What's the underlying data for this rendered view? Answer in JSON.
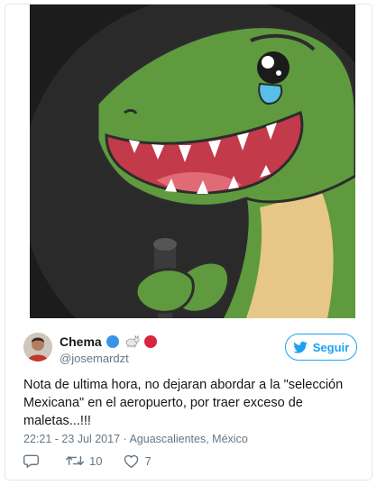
{
  "tweet": {
    "display_name": "Chema",
    "handle": "@josemardzt",
    "follow_label": "Seguir",
    "text": "Nota de ultima hora, no dejaran abordar a la \"selección Mexicana\" en el aeropuerto, por traer exceso de maletas...!!!",
    "timestamp": "22:21 - 23 Jul 2017",
    "separator": " · ",
    "location": "Aguascalientes, México",
    "retweets": "10",
    "likes": "7",
    "name_emojis": [
      "blue-circle",
      "goat",
      "red-circle"
    ],
    "colors": {
      "accent": "#1da1f2",
      "text": "#14171a",
      "secondary": "#657786",
      "border": "#e1e8ed"
    }
  },
  "media": {
    "icon": "crying-dinosaur-with-microphone-illustration"
  }
}
